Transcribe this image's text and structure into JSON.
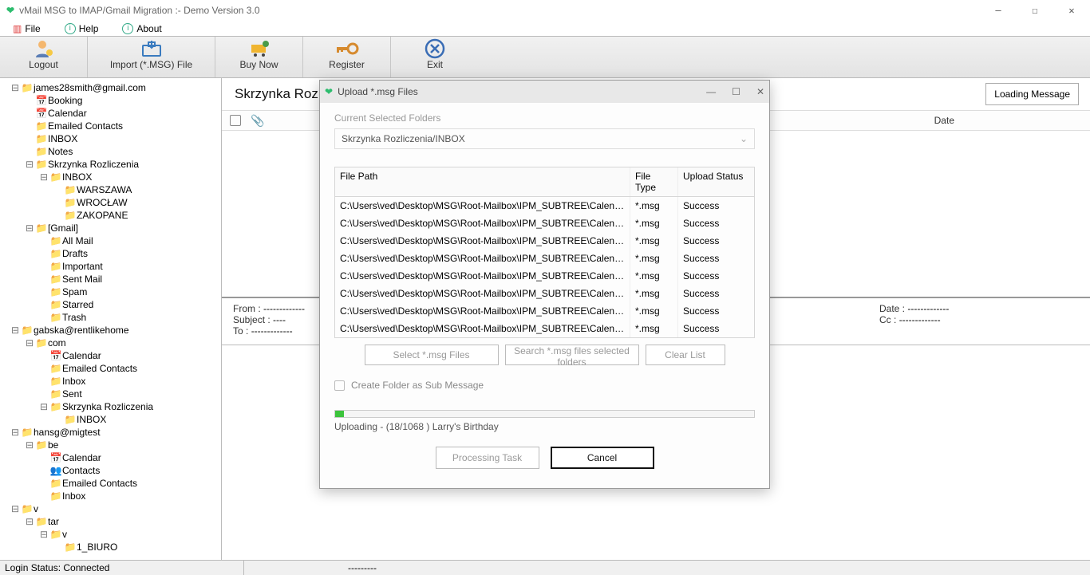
{
  "window": {
    "title": "vMail MSG to IMAP/Gmail Migration :- Demo Version 3.0"
  },
  "menu": {
    "file": "File",
    "help": "Help",
    "about": "About"
  },
  "toolbar": {
    "logout": "Logout",
    "import": "Import (*.MSG) File",
    "buynow": "Buy Now",
    "register": "Register",
    "exit": "Exit"
  },
  "tree": [
    {
      "d": 0,
      "tw": "-",
      "i": "📁",
      "t": "james28smith@gmail.com"
    },
    {
      "d": 1,
      "tw": "",
      "i": "📅",
      "t": "Booking"
    },
    {
      "d": 1,
      "tw": "",
      "i": "📅",
      "t": "Calendar"
    },
    {
      "d": 1,
      "tw": "",
      "i": "📁",
      "t": "Emailed Contacts"
    },
    {
      "d": 1,
      "tw": "",
      "i": "📁",
      "t": "INBOX"
    },
    {
      "d": 1,
      "tw": "",
      "i": "📁",
      "t": "Notes"
    },
    {
      "d": 1,
      "tw": "-",
      "i": "📁",
      "t": "Skrzynka Rozliczenia"
    },
    {
      "d": 2,
      "tw": "-",
      "i": "📁",
      "t": "INBOX"
    },
    {
      "d": 3,
      "tw": "",
      "i": "📁",
      "t": "WARSZAWA"
    },
    {
      "d": 3,
      "tw": "",
      "i": "📁",
      "t": "WROCŁAW"
    },
    {
      "d": 3,
      "tw": "",
      "i": "📁",
      "t": "ZAKOPANE"
    },
    {
      "d": 1,
      "tw": "-",
      "i": "📁",
      "t": "[Gmail]"
    },
    {
      "d": 2,
      "tw": "",
      "i": "📁",
      "t": "All Mail"
    },
    {
      "d": 2,
      "tw": "",
      "i": "📁",
      "t": "Drafts"
    },
    {
      "d": 2,
      "tw": "",
      "i": "📁",
      "t": "Important"
    },
    {
      "d": 2,
      "tw": "",
      "i": "📁",
      "t": "Sent Mail"
    },
    {
      "d": 2,
      "tw": "",
      "i": "📁",
      "t": "Spam"
    },
    {
      "d": 2,
      "tw": "",
      "i": "📁",
      "t": "Starred"
    },
    {
      "d": 2,
      "tw": "",
      "i": "📁",
      "t": "Trash"
    },
    {
      "d": 0,
      "tw": "-",
      "i": "📁",
      "t": "gabska@rentlikehome"
    },
    {
      "d": 1,
      "tw": "-",
      "i": "📁",
      "t": "com"
    },
    {
      "d": 2,
      "tw": "",
      "i": "📅",
      "t": "Calendar"
    },
    {
      "d": 2,
      "tw": "",
      "i": "📁",
      "t": "Emailed Contacts"
    },
    {
      "d": 2,
      "tw": "",
      "i": "📁",
      "t": "Inbox"
    },
    {
      "d": 2,
      "tw": "",
      "i": "📁",
      "t": "Sent"
    },
    {
      "d": 2,
      "tw": "-",
      "i": "📁",
      "t": "Skrzynka Rozliczenia"
    },
    {
      "d": 3,
      "tw": "",
      "i": "📁",
      "t": "INBOX"
    },
    {
      "d": 0,
      "tw": "-",
      "i": "📁",
      "t": "hansg@migtest"
    },
    {
      "d": 1,
      "tw": "-",
      "i": "📁",
      "t": "be"
    },
    {
      "d": 2,
      "tw": "",
      "i": "📅",
      "t": "Calendar"
    },
    {
      "d": 2,
      "tw": "",
      "i": "👥",
      "t": "Contacts"
    },
    {
      "d": 2,
      "tw": "",
      "i": "📁",
      "t": "Emailed Contacts"
    },
    {
      "d": 2,
      "tw": "",
      "i": "📁",
      "t": "Inbox"
    },
    {
      "d": 0,
      "tw": "-",
      "i": "📁",
      "t": "v"
    },
    {
      "d": 1,
      "tw": "-",
      "i": "📁",
      "t": "tar"
    },
    {
      "d": 2,
      "tw": "-",
      "i": "📁",
      "t": "v"
    },
    {
      "d": 3,
      "tw": "",
      "i": "📁",
      "t": "1_BIURO"
    }
  ],
  "content": {
    "heading": "Skrzynka Rozlicz",
    "loading": "Loading Message",
    "date_col": "Date"
  },
  "detail": {
    "from_l": "From :",
    "from_v": "-------------",
    "subj_l": "Subject :",
    "subj_v": "----",
    "to_l": "To :",
    "to_v": "-------------",
    "date_l": "Date :",
    "date_v": "-------------",
    "cc_l": "Cc :",
    "cc_v": "-------------"
  },
  "status": {
    "login": "Login Status: Connected",
    "right": "---------"
  },
  "dialog": {
    "title": "Upload *.msg Files",
    "section": "Current Selected Folders",
    "combo": "Skrzynka Rozliczenia/INBOX",
    "th1": "File Path",
    "th2": "File Type",
    "th3": "Upload Status",
    "rows": [
      {
        "p": "C:\\Users\\ved\\Desktop\\MSG\\Root-Mailbox\\IPM_SUBTREE\\Calendar\\Ha...",
        "t": "*.msg",
        "s": "Success"
      },
      {
        "p": "C:\\Users\\ved\\Desktop\\MSG\\Root-Mailbox\\IPM_SUBTREE\\Calendar\\JA...",
        "t": "*.msg",
        "s": "Success"
      },
      {
        "p": "C:\\Users\\ved\\Desktop\\MSG\\Root-Mailbox\\IPM_SUBTREE\\Calendar\\Ja...",
        "t": "*.msg",
        "s": "Success"
      },
      {
        "p": "C:\\Users\\ved\\Desktop\\MSG\\Root-Mailbox\\IPM_SUBTREE\\Calendar\\JA...",
        "t": "*.msg",
        "s": "Success"
      },
      {
        "p": "C:\\Users\\ved\\Desktop\\MSG\\Root-Mailbox\\IPM_SUBTREE\\Calendar\\Ja...",
        "t": "*.msg",
        "s": "Success"
      },
      {
        "p": "C:\\Users\\ved\\Desktop\\MSG\\Root-Mailbox\\IPM_SUBTREE\\Calendar\\Ja...",
        "t": "*.msg",
        "s": "Success"
      },
      {
        "p": "C:\\Users\\ved\\Desktop\\MSG\\Root-Mailbox\\IPM_SUBTREE\\Calendar\\Ja...",
        "t": "*.msg",
        "s": "Success"
      },
      {
        "p": "C:\\Users\\ved\\Desktop\\MSG\\Root-Mailbox\\IPM_SUBTREE\\Calendar\\Lar...",
        "t": "*.msg",
        "s": "Success"
      }
    ],
    "btn_select": "Select *.msg Files",
    "btn_search": "Search *.msg files selected folders",
    "btn_clear": "Clear List",
    "chk": "Create Folder as Sub Message",
    "progress": "Uploading - (18/1068 ) Larry's Birthday",
    "btn_proc": "Processing Task",
    "btn_cancel": "Cancel"
  }
}
